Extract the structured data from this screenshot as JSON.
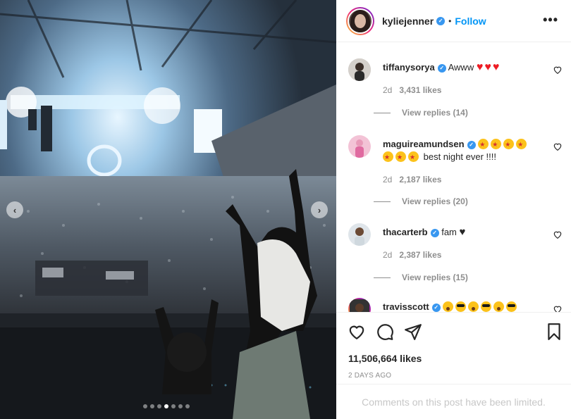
{
  "post": {
    "author": "kyliejenner",
    "follow_label": "Follow",
    "separator": "•",
    "more_label": "•••",
    "likes": "11,506,664 likes",
    "time_ago": "2 DAYS AGO",
    "comments_limited": "Comments on this post have been limited."
  },
  "carousel": {
    "prev_label": "‹",
    "next_label": "›",
    "total_slides": 7,
    "active_slide": 4
  },
  "comments": [
    {
      "user": "tiffanysorya",
      "text": "Awww",
      "emojis": [
        "red-heart",
        "red-heart",
        "red-heart"
      ],
      "age": "2d",
      "likes": "3,431 likes",
      "replies": "View replies (14)"
    },
    {
      "user": "maguireamundsen",
      "text": "best night ever !!!!",
      "emojis": [
        "star-struck",
        "star-struck",
        "star-struck",
        "star-struck",
        "star-struck",
        "star-struck",
        "star-struck"
      ],
      "age": "2d",
      "likes": "2,187 likes",
      "replies": "View replies (20)"
    },
    {
      "user": "thacarterb",
      "text": "fam",
      "emojis": [
        "black-heart"
      ],
      "age": "2d",
      "likes": "2,387 likes",
      "replies": "View replies (15)"
    },
    {
      "user": "travisscott",
      "text": "",
      "emojis": [
        "astonished-face",
        "cool-face",
        "astonished-face",
        "cool-face",
        "astonished-face",
        "cool-face"
      ]
    }
  ],
  "icons": {
    "like": "heart-outline-icon",
    "comment": "speech-bubble-icon",
    "share": "paper-plane-icon",
    "save": "bookmark-icon",
    "verified": "verified-badge-icon"
  },
  "colors": {
    "link": "#0095f6",
    "verified": "#3897f0",
    "muted": "#8e8e8e",
    "limited": "#c7c7c7"
  }
}
